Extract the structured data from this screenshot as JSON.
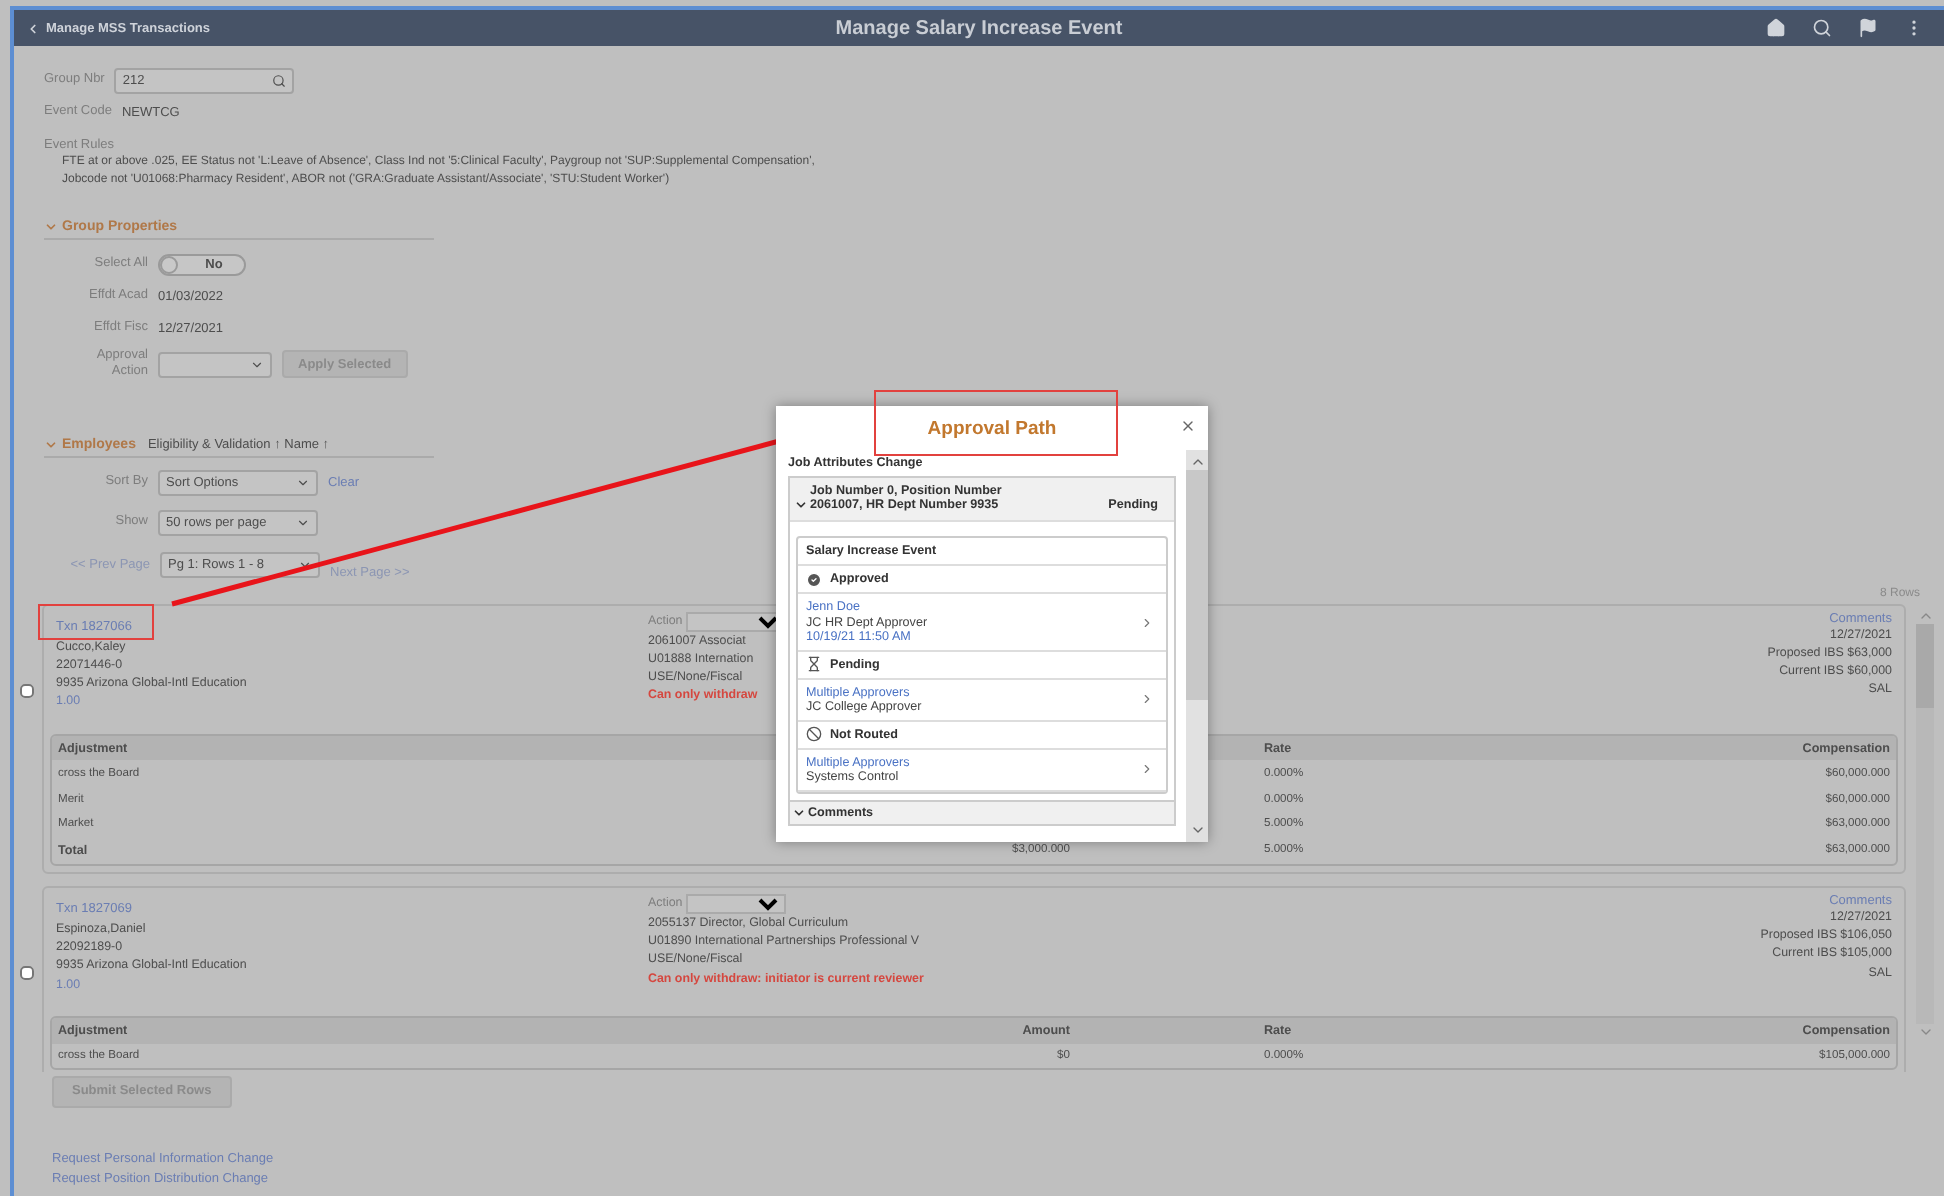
{
  "header": {
    "back_label": "Manage MSS Transactions",
    "title": "Manage Salary Increase Event"
  },
  "group": {
    "fields": [
      {
        "kind": "lookup",
        "label": "Group Nbr",
        "value": "212"
      },
      {
        "kind": "text",
        "label": "Event Code",
        "value": "NEWTCG"
      }
    ],
    "rules_label": "Event Rules",
    "rules_text": "FTE at or above .025, EE Status not 'L:Leave of Absence', Class Ind not '5:Clinical Faculty', Paygroup not 'SUP:Supplemental Compensation', Jobcode not 'U01068:Pharmacy Resident', ABOR not ('GRA:Graduate Assistant/Associate', 'STU:Student Worker')"
  },
  "group_properties": {
    "title": "Group Properties",
    "expanded": true,
    "fields": [
      {
        "kind": "toggle",
        "label": "Select All",
        "value": "No",
        "on": false
      },
      {
        "kind": "text",
        "label": "Effdt Acad",
        "value": "01/03/2022"
      },
      {
        "kind": "text",
        "label": "Effdt Fisc",
        "value": "12/27/2021"
      },
      {
        "kind": "action",
        "label": "Approval Action",
        "button": "Apply Selected"
      }
    ]
  },
  "employees": {
    "title": "Employees",
    "expanded": true,
    "sort_info": "Eligibility & Validation ↑ Name ↑",
    "sort_by": {
      "label": "Sort By",
      "value": "Sort Options",
      "clear": "Clear"
    },
    "show": {
      "label": "Show",
      "value": "50 rows per page"
    },
    "pager": {
      "prev": "<< Prev Page",
      "value": "Pg 1: Rows 1 - 8",
      "next": "Next Page >>"
    },
    "row_count": "8 Rows",
    "rows": [
      {
        "txn": "Txn 1827066",
        "highlighted": true,
        "checked": false,
        "name": "Cucco,Kaley",
        "emplid": "22071446-0",
        "dept": "9935 Arizona Global-Intl Education",
        "fte": "1.00",
        "action_label": "Action",
        "job": "2061007 Associat",
        "position": "U01888 Internation",
        "funding": "USE/None/Fiscal",
        "warning": "Can only withdraw",
        "comments": "Comments",
        "date": "12/27/2021",
        "proposed": "Proposed IBS $63,000",
        "current": "Current IBS $60,000",
        "type": "SAL",
        "columns": {
          "adjustment": "Adjustment",
          "rate": "Rate",
          "compensation": "Compensation"
        },
        "adjustments": [
          {
            "label": "cross the Board",
            "rate": "0.000%",
            "compensation": "$60,000.000"
          },
          {
            "label": "Merit",
            "rate": "0.000%",
            "compensation": "$60,000.000"
          },
          {
            "label": "Market",
            "rate": "5.000%",
            "compensation": "$63,000.000"
          },
          {
            "label": "Total",
            "total": true,
            "amount": "$3,000.000",
            "rate": "5.000%",
            "compensation": "$63,000.000"
          }
        ]
      },
      {
        "txn": "Txn 1827069",
        "highlighted": false,
        "checked": false,
        "name": "Espinoza,Daniel",
        "emplid": "22092189-0",
        "dept": "9935 Arizona Global-Intl Education",
        "fte": "1.00",
        "action_label": "Action",
        "job": "2055137 Director, Global Curriculum",
        "position": "U01890 International Partnerships Professional V",
        "funding": "USE/None/Fiscal",
        "warning": "Can only withdraw: initiator is current reviewer",
        "comments": "Comments",
        "date": "12/27/2021",
        "proposed": "Proposed IBS $106,050",
        "current": "Current IBS $105,000",
        "type": "SAL",
        "columns": {
          "adjustment": "Adjustment",
          "amount": "Amount",
          "rate": "Rate",
          "compensation": "Compensation"
        },
        "adjustments": [
          {
            "label": "cross the Board",
            "amount": "$0",
            "rate": "0.000%",
            "compensation": "$105,000.000"
          }
        ]
      }
    ]
  },
  "submit_button": "Submit Selected Rows",
  "links": [
    "Request Personal Information Change",
    "Request Position Distribution Change"
  ],
  "modal": {
    "title": "Approval Path",
    "highlighted": true,
    "section": "Job Attributes Change",
    "job": {
      "title_lines": [
        "Job Number 0, Position Number",
        "2061007, HR Dept Number 9935"
      ],
      "status": "Pending",
      "expanded": true
    },
    "event": "Salary Increase Event",
    "steps": [
      {
        "kind": "approved",
        "status": "Approved",
        "approver": "Jenn Doe",
        "role": "JC HR Dept Approver",
        "time": "10/19/21 11:50 AM"
      },
      {
        "kind": "pending",
        "status": "Pending",
        "approver": "Multiple Approvers",
        "role": "JC College Approver"
      },
      {
        "kind": "not_routed",
        "status": "Not Routed",
        "approver": "Multiple Approvers",
        "role": "Systems Control"
      }
    ],
    "comments": {
      "label": "Comments",
      "expanded": true
    }
  }
}
